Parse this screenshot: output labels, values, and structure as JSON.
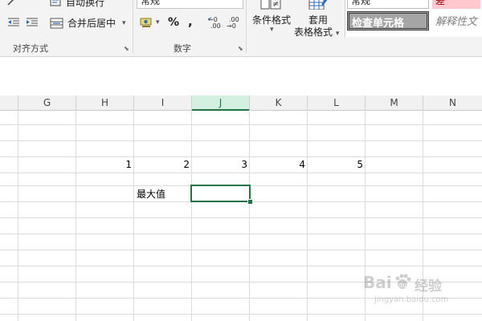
{
  "ribbon": {
    "alignment": {
      "wrap_text_label": "自动换行",
      "merge_center_label": "合并后居中",
      "group_label": "对齐方式"
    },
    "number": {
      "format_value": "常规",
      "percent_symbol": "%",
      "comma_symbol": ",",
      "group_label": "数字"
    },
    "styles": {
      "conditional_format_label": "条件格式",
      "format_as_table_line1": "套用",
      "format_as_table_line2": "表格格式",
      "style_normal": "常规",
      "style_bad": "差",
      "style_check_cell": "检查单元格",
      "style_explanatory": "解释性文"
    }
  },
  "columns": [
    "G",
    "H",
    "I",
    "J",
    "K",
    "L",
    "M",
    "N"
  ],
  "active_column": "J",
  "cells": {
    "h_value": "1",
    "i_value": "2",
    "j_value": "3",
    "k_value": "4",
    "l_value": "5",
    "i_label": "最大值"
  },
  "watermark": {
    "brand": "Bai",
    "paw": "du",
    "suffix": "经验",
    "url": "jingyan.baidu.com"
  },
  "colors": {
    "accent": "#217346",
    "check_cell_bg": "#a5a5a5",
    "bad_style_bg": "#ffc7ce"
  }
}
